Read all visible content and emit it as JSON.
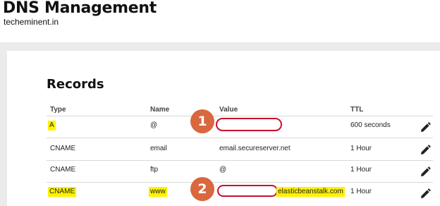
{
  "header": {
    "title": "DNS Management",
    "domain": "techeminent.in"
  },
  "records": {
    "section_title": "Records",
    "columns": [
      "Type",
      "Name",
      "Value",
      "TTL"
    ],
    "rows": [
      {
        "type": "A",
        "name": "@",
        "value": "",
        "ttl": "600 seconds"
      },
      {
        "type": "CNAME",
        "name": "email",
        "value": "email.secureserver.net",
        "ttl": "1 Hour"
      },
      {
        "type": "CNAME",
        "name": "ftp",
        "value": "@",
        "ttl": "1 Hour"
      },
      {
        "type": "CNAME",
        "name": "www",
        "value": "elasticbeanstalk.com",
        "ttl": "1 Hour"
      }
    ]
  },
  "annotations": {
    "badge_1": "1",
    "badge_2": "2",
    "badge_color": "#d9673f",
    "redaction_color": "#c8102e",
    "highlight_color": "#fff200"
  },
  "icons": {
    "edit": "pencil-icon"
  }
}
